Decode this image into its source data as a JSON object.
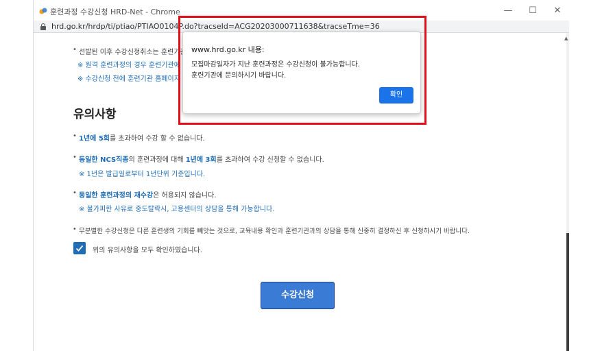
{
  "window": {
    "title": "훈련과정 수강신청 HRD-Net - Chrome",
    "url": "hrd.go.kr/hrdp/ti/ptiao/PTIAO0104P.do?tracseId=ACG20203000711638&tracseTme=36",
    "minimize_glyph": "—",
    "maximize_glyph": "☐",
    "close_glyph": "✕"
  },
  "intro": {
    "bullet_text": "선발된 이후 수강신청취소는 훈련기관",
    "note1": "※ 원격 훈련과정의 경우 훈련기관에",
    "note2": "※ 수강신청 전에 훈련기관 홈페이지"
  },
  "notice": {
    "title": "유의사항",
    "item1": {
      "highlight": "1년에 5회",
      "text": "를 초과하여 수강 할 수 없습니다."
    },
    "item2": {
      "highlight1": "동일한 NCS직종",
      "text1": "의 훈련과정에 대해 ",
      "highlight2": "1년에 3회",
      "text2": "를 초과하여 수강 신청할 수 없습니다.",
      "note": "※ 1년은 발급일로부터 1년단위 기준입니다."
    },
    "item3": {
      "highlight": "동일한 훈련과정의 재수강",
      "text": "은 허용되지 않습니다.",
      "note": "※ 불가피한 사유로 중도탈락시, 고용센터의 상담을 통해 가능합니다."
    },
    "item4": "무분별한 수강신청은 다른 훈련생의 기회를 빼앗는 것으로, 교육내용 확인과 훈련기관과의 상담을 통해 신중히 결정하신 후 신청하시기 바랍니다.",
    "confirm_label": "위의 유의사항을 모두 확인하였습니다.",
    "confirm_checked": true
  },
  "apply_button_label": "수강신청",
  "dialog": {
    "origin": "www.hrd.go.kr 내용:",
    "message_line1": "모집마감일자가 지난 훈련과정은 수강신청이 불가능합니다.",
    "message_line2": "훈련기관에 문의하시기 바랍니다.",
    "ok_label": "확인"
  },
  "colors": {
    "accent": "#1f6db5",
    "button": "#3a7bd5",
    "dialog_button": "#1a73e8",
    "highlight_box": "#e0101a"
  }
}
